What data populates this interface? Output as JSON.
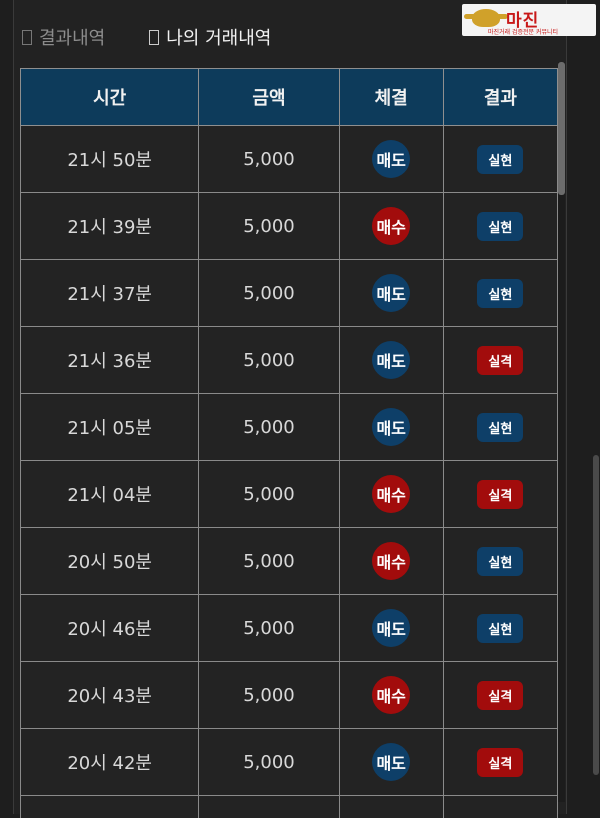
{
  "tabs": [
    {
      "label": "결과내역",
      "active": false
    },
    {
      "label": "나의 거래내역",
      "active": true
    }
  ],
  "logo": {
    "name": "마진",
    "tagline": "마진거래 검증전문 커뮤니티"
  },
  "table": {
    "headers": [
      "시간",
      "금액",
      "체결",
      "결과"
    ],
    "rows": [
      {
        "time": "21시 50분",
        "amount": "5,000",
        "trade": "매도",
        "result": "실현"
      },
      {
        "time": "21시 39분",
        "amount": "5,000",
        "trade": "매수",
        "result": "실현"
      },
      {
        "time": "21시 37분",
        "amount": "5,000",
        "trade": "매도",
        "result": "실현"
      },
      {
        "time": "21시 36분",
        "amount": "5,000",
        "trade": "매도",
        "result": "실격"
      },
      {
        "time": "21시 05분",
        "amount": "5,000",
        "trade": "매도",
        "result": "실현"
      },
      {
        "time": "21시 04분",
        "amount": "5,000",
        "trade": "매수",
        "result": "실격"
      },
      {
        "time": "20시 50분",
        "amount": "5,000",
        "trade": "매수",
        "result": "실현"
      },
      {
        "time": "20시 46분",
        "amount": "5,000",
        "trade": "매도",
        "result": "실현"
      },
      {
        "time": "20시 43분",
        "amount": "5,000",
        "trade": "매수",
        "result": "실격"
      },
      {
        "time": "20시 42분",
        "amount": "5,000",
        "trade": "매도",
        "result": "실격"
      }
    ]
  },
  "colors": {
    "header_bg": "#0d3b5b",
    "sell": "#0e3f68",
    "buy": "#a20c0c"
  }
}
